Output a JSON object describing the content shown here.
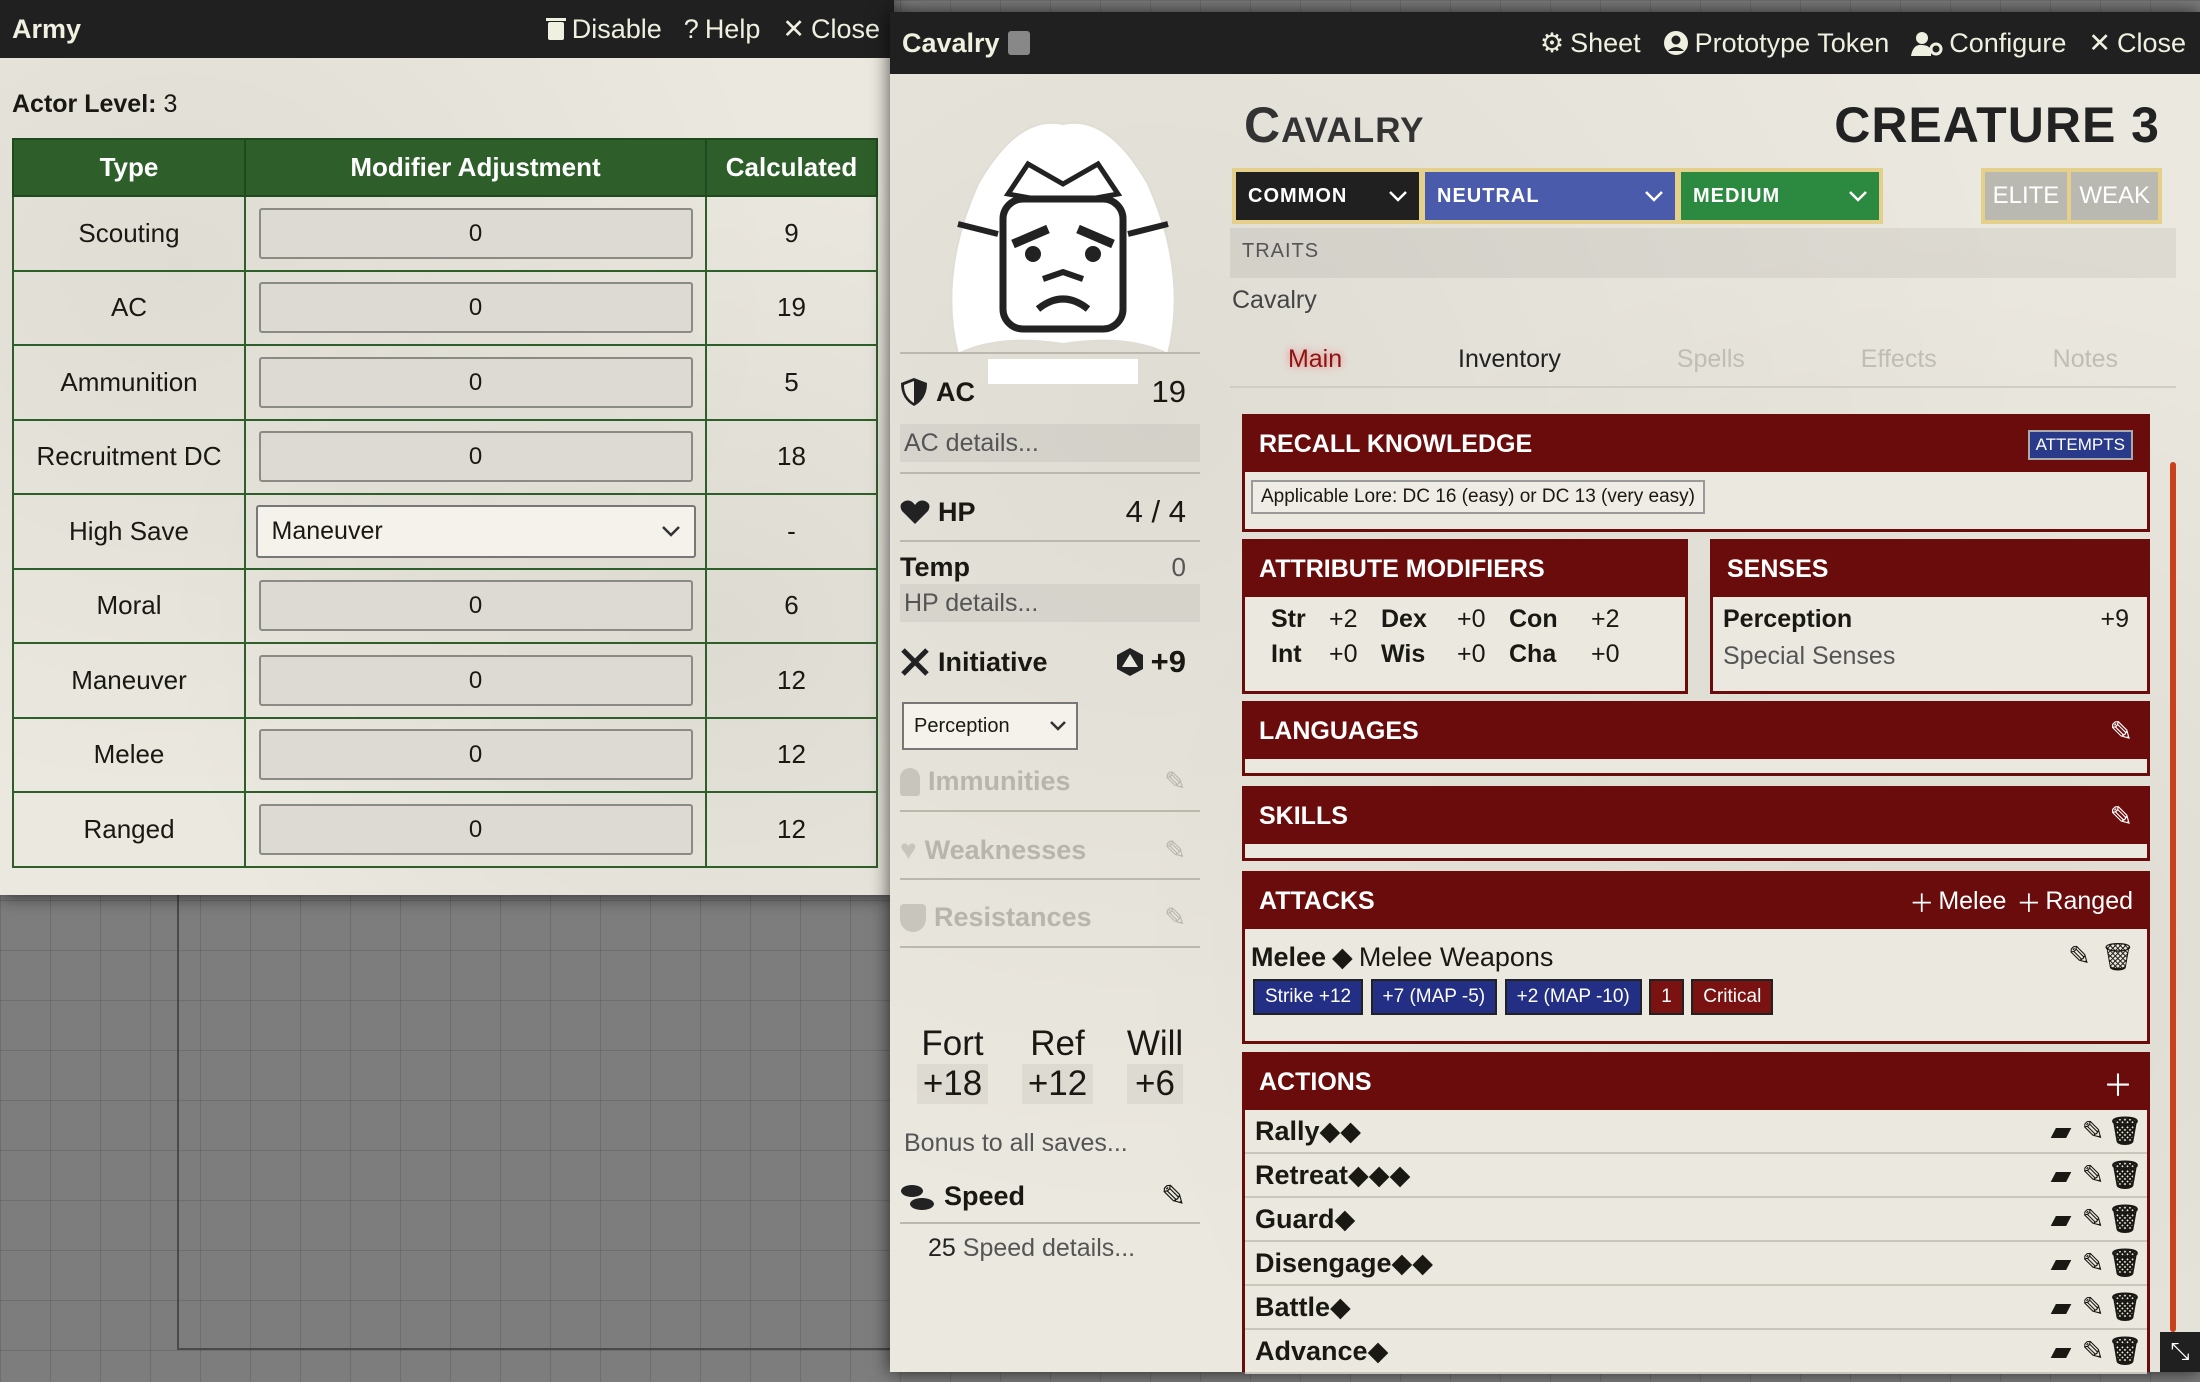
{
  "army": {
    "title": "Army",
    "controls": {
      "disable": "Disable",
      "help": "Help",
      "close": "Close"
    },
    "actor_level_label": "Actor Level:",
    "actor_level": "3",
    "headers": {
      "type": "Type",
      "modifier": "Modifier Adjustment",
      "calculated": "Calculated"
    },
    "rows": [
      {
        "type": "Scouting",
        "adj": "0",
        "calc": "9"
      },
      {
        "type": "AC",
        "adj": "0",
        "calc": "19"
      },
      {
        "type": "Ammunition",
        "adj": "0",
        "calc": "5"
      },
      {
        "type": "Recruitment DC",
        "adj": "0",
        "calc": "18"
      },
      {
        "type": "High Save",
        "adj": "Maneuver",
        "calc": "-"
      },
      {
        "type": "Moral",
        "adj": "0",
        "calc": "6"
      },
      {
        "type": "Maneuver",
        "adj": "0",
        "calc": "12"
      },
      {
        "type": "Melee",
        "adj": "0",
        "calc": "12"
      },
      {
        "type": "Ranged",
        "adj": "0",
        "calc": "12"
      }
    ]
  },
  "cavalry": {
    "title": "Cavalry",
    "controls": {
      "sheet": "Sheet",
      "token": "Prototype Token",
      "configure": "Configure",
      "close": "Close"
    },
    "name": "Cavalry",
    "level": "CREATURE 3",
    "rarity": "COMMON",
    "alignment": "NEUTRAL",
    "size": "MEDIUM",
    "elite": "ELITE",
    "weak": "WEAK",
    "traits_label": "TRAITS",
    "traits_value": "Cavalry",
    "tabs": [
      "Main",
      "Inventory",
      "Spells",
      "Effects",
      "Notes"
    ],
    "left": {
      "ac_label": "AC",
      "ac": "19",
      "ac_details": "AC details...",
      "hp_label": "HP",
      "hp": "4 / 4",
      "temp_label": "Temp",
      "temp": "0",
      "hp_details": "HP details...",
      "init_label": "Initiative",
      "init": "+9",
      "init_select": "Perception",
      "immunities": "Immunities",
      "weaknesses": "Weaknesses",
      "resistances": "Resistances",
      "fort": "Fort",
      "fort_val": "+18",
      "ref": "Ref",
      "ref_val": "+12",
      "will": "Will",
      "will_val": "+6",
      "save_bonus": "Bonus to all saves...",
      "speed_label": "Speed",
      "speed": "25",
      "speed_details": "Speed details..."
    },
    "recall": {
      "title": "RECALL KNOWLEDGE",
      "attempts": "ATTEMPTS",
      "lore": "Applicable Lore: DC 16 (easy) or DC 13 (very easy)"
    },
    "attrs": {
      "title": "ATTRIBUTE MODIFIERS",
      "str": "Str",
      "str_v": "+2",
      "dex": "Dex",
      "dex_v": "+0",
      "con": "Con",
      "con_v": "+2",
      "int": "Int",
      "int_v": "+0",
      "wis": "Wis",
      "wis_v": "+0",
      "cha": "Cha",
      "cha_v": "+0"
    },
    "senses": {
      "title": "SENSES",
      "perception": "Perception",
      "perception_v": "+9",
      "special": "Special Senses"
    },
    "languages": "LANGUAGES",
    "skills": "SKILLS",
    "attacks": {
      "title": "ATTACKS",
      "add_melee": "Melee",
      "add_ranged": "Ranged",
      "name": "Melee",
      "weapon": "Melee Weapons",
      "strike": "Strike +12",
      "map1": "+7 (MAP -5)",
      "map2": "+2 (MAP -10)",
      "dmg": "1",
      "crit": "Critical"
    },
    "actions": {
      "title": "ACTIONS",
      "items": [
        "Rally",
        "Retreat",
        "Guard",
        "Disengage",
        "Battle",
        "Advance"
      ]
    }
  }
}
